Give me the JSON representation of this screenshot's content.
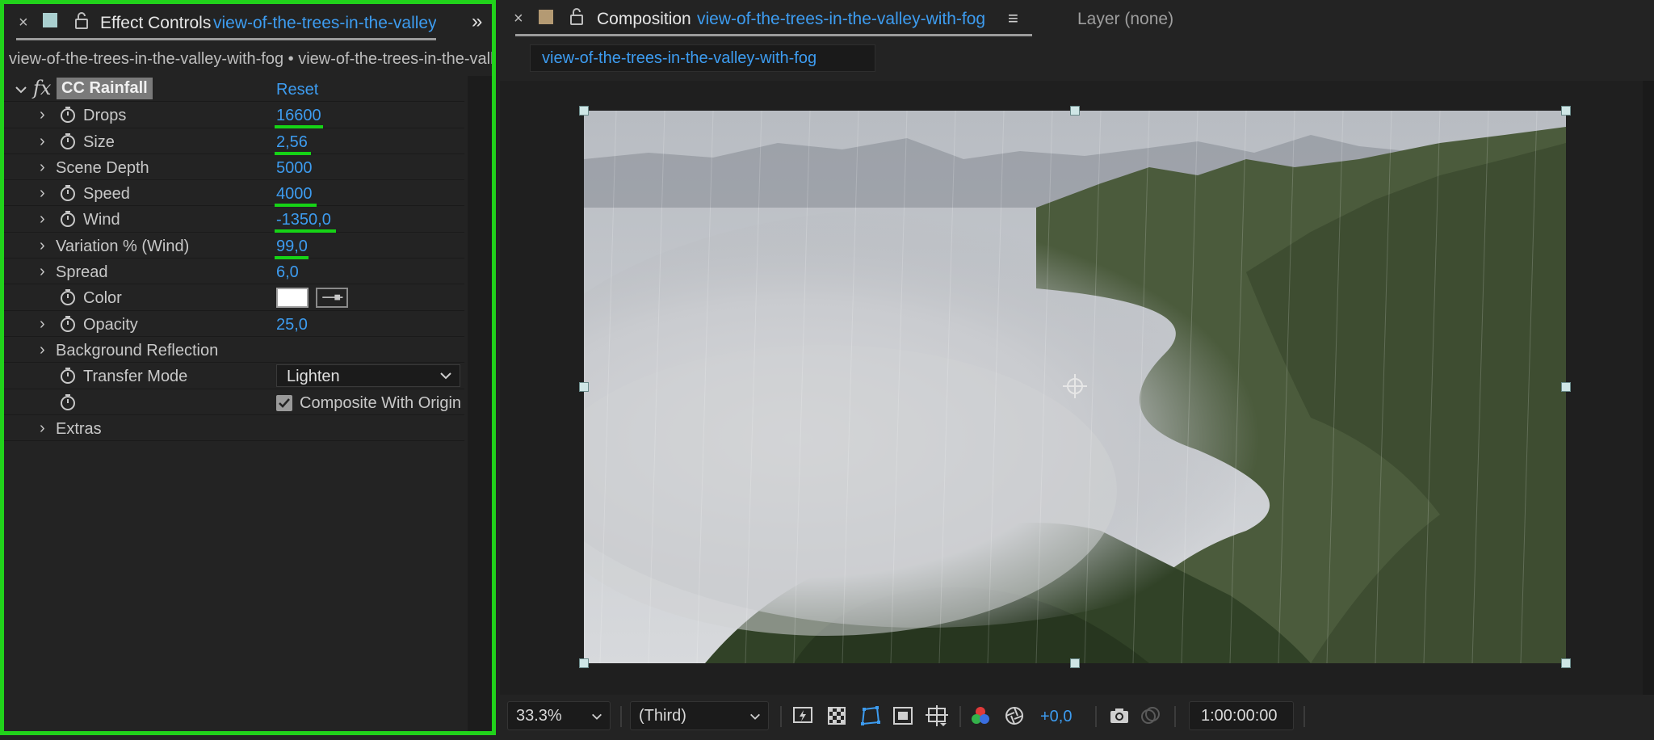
{
  "effect_controls": {
    "tab_title": "Effect Controls",
    "tab_layer": "view-of-the-trees-in-the-valley-with-fog",
    "path": "view-of-the-trees-in-the-valley-with-fog • view-of-the-trees-in-the-valley-with-fog",
    "effect_name": "CC Rainfall",
    "reset_label": "Reset",
    "properties": [
      {
        "label": "Drops",
        "value": "16600"
      },
      {
        "label": "Size",
        "value": "2,56"
      },
      {
        "label": "Scene Depth",
        "value": "5000"
      },
      {
        "label": "Speed",
        "value": "4000"
      },
      {
        "label": "Wind",
        "value": "-1350,0"
      },
      {
        "label": "Variation % (Wind)",
        "value": "99,0"
      },
      {
        "label": "Spread",
        "value": "6,0"
      },
      {
        "label": "Color",
        "value": ""
      },
      {
        "label": "Opacity",
        "value": "25,0"
      },
      {
        "label": "Background Reflection",
        "value": ""
      },
      {
        "label": "Transfer Mode",
        "value": "Lighten"
      },
      {
        "label": "",
        "value": "Composite With Original"
      },
      {
        "label": "Extras",
        "value": ""
      }
    ]
  },
  "composition": {
    "tab_title": "Composition",
    "comp_name": "view-of-the-trees-in-the-valley-with-fog",
    "layer_tab": "Layer (none)",
    "viewer_tab": "view-of-the-trees-in-the-valley-with-fog"
  },
  "toolbar": {
    "zoom": "33.3%",
    "resolution": "(Third)",
    "exposure": "+0,0",
    "timecode": "1:00:00:00"
  },
  "colors": {
    "accent_blue": "#3d9cf0",
    "highlight_green": "#21d21b",
    "panel_bg": "#232323"
  }
}
